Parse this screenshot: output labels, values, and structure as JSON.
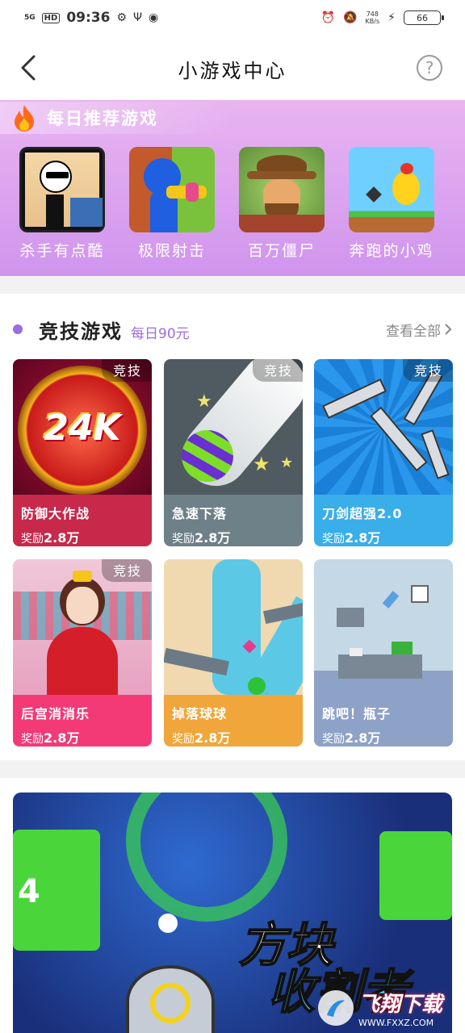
{
  "status_bar": {
    "network": "5G",
    "hd": "HD",
    "time": "09:36",
    "speed_value": "748",
    "speed_unit": "KB/s",
    "battery": "66"
  },
  "header": {
    "title": "小游戏中心",
    "help": "?"
  },
  "daily": {
    "title": "每日推荐游戏",
    "games": [
      {
        "name": "杀手有点酷"
      },
      {
        "name": "极限射击"
      },
      {
        "name": "百万僵尸"
      },
      {
        "name": "奔跑的小鸡"
      }
    ]
  },
  "competitive": {
    "title": "竞技游戏",
    "subtitle": "每日90元",
    "see_all": "查看全部",
    "cards": [
      {
        "name": "防御大作战",
        "reward_prefix": "奖励",
        "reward": "2.8万",
        "badge": "竞技",
        "foot_color": "#c8284a",
        "art_text": "24K"
      },
      {
        "name": "急速下落",
        "reward_prefix": "奖励",
        "reward": "2.8万",
        "badge": "竞技",
        "foot_color": "#6e8088"
      },
      {
        "name": "刀剑超强2.0",
        "reward_prefix": "奖励",
        "reward": "2.8万",
        "badge": "竞技",
        "foot_color": "#3aaee8"
      },
      {
        "name": "后宫消消乐",
        "reward_prefix": "奖励",
        "reward": "2.8万",
        "badge": "竞技",
        "foot_color": "#f33a76"
      },
      {
        "name": "掉落球球",
        "reward_prefix": "奖励",
        "reward": "2.8万",
        "badge": "",
        "foot_color": "#f0a63a"
      },
      {
        "name": "跳吧！瓶子",
        "reward_prefix": "奖励",
        "reward": "2.8万",
        "badge": "",
        "foot_color": "#8ea2c8"
      }
    ]
  },
  "banner": {
    "line1": "方块",
    "line2": "收割者",
    "score": "4",
    "watermark": "飞翔下载",
    "watermark_url": "WWW.FXXZ.COM"
  }
}
